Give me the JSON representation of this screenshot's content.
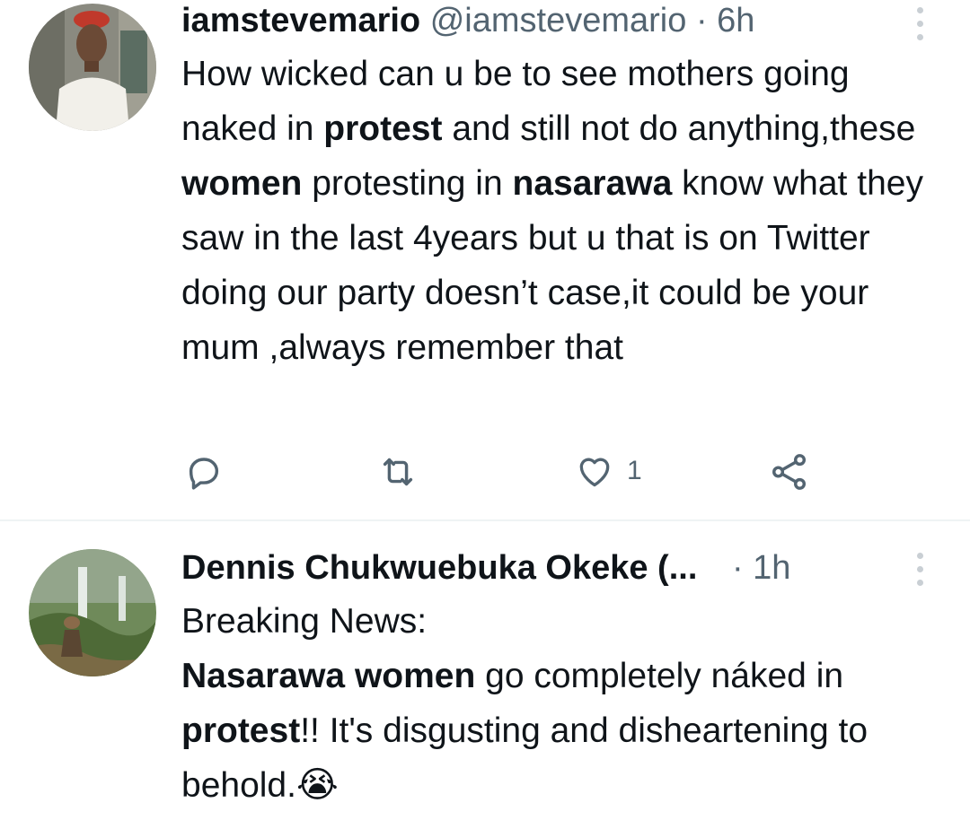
{
  "tweets": [
    {
      "author_name": "iamstevemario",
      "handle": "@iamstevemario",
      "separator": "·",
      "time": "6h",
      "text_segments": [
        {
          "t": "How wicked can u be to see mothers going naked in "
        },
        {
          "t": "protest",
          "bold": true
        },
        {
          "t": " and still not do anything,these "
        },
        {
          "t": "women",
          "bold": true
        },
        {
          "t": " protesting in "
        },
        {
          "t": "nasarawa",
          "bold": true
        },
        {
          "t": " know what they saw in the last 4years but u that is on Twitter doing our party doesn’t case,it could be your mum ,always remember that"
        }
      ],
      "like_count": "1",
      "icons": {
        "reply": "reply-icon",
        "retweet": "retweet-icon",
        "like": "heart-icon",
        "share": "share-icon",
        "more": "more-vertical-icon"
      }
    },
    {
      "author_name": "Dennis Chukwuebuka Okeke (...",
      "separator": "·",
      "time": "1h",
      "text_segments": [
        {
          "t": "Breaking News:"
        },
        {
          "t": "\n"
        },
        {
          "t": "Nasarawa women",
          "bold": true
        },
        {
          "t": " go completely nákеd in "
        },
        {
          "t": "protest",
          "bold": true
        },
        {
          "t": "!! It's disgusting and disheartening to behold."
        }
      ],
      "emoji": "😭",
      "icons": {
        "more": "more-vertical-icon"
      }
    }
  ],
  "colors": {
    "text": "#0f1419",
    "secondary": "#536471",
    "divider": "#eff3f4"
  }
}
